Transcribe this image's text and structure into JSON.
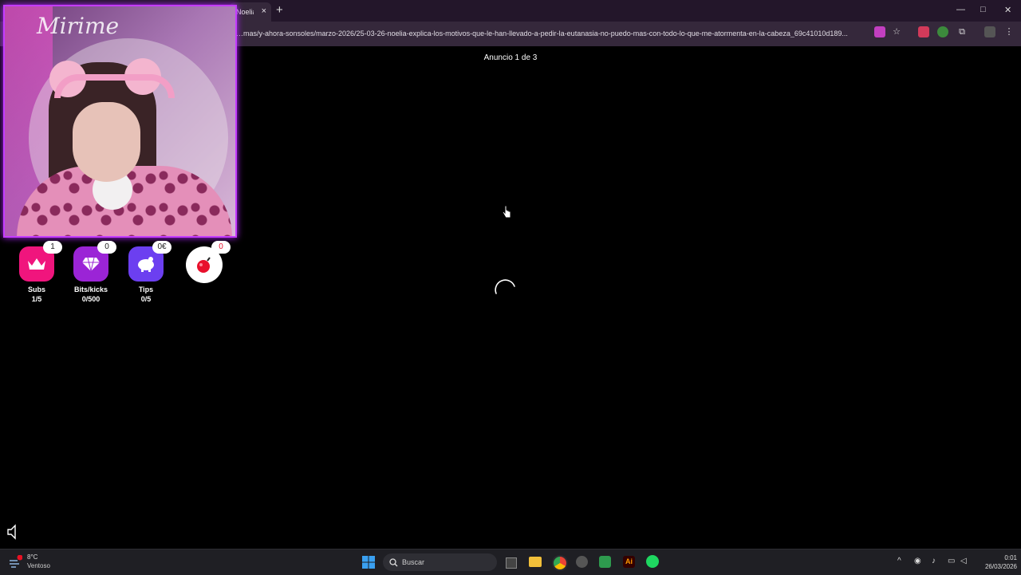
{
  "browser": {
    "tab_title": "Noelia",
    "tab_close": "×",
    "new_tab": "+",
    "url": "…mas/y-ahora-sonsoles/marzo-2026/25-03-26-noelia-explica-los-motivos-que-le-han-llevado-a-pedir-la-eutanasia-no-puedo-mas-con-todo-lo-que-me-atormenta-en-la-cabeza_69c41010d189...",
    "window_controls": [
      "—",
      "□",
      "✕"
    ]
  },
  "page": {
    "ad_label": "Anuncio 1 de 3"
  },
  "overlay": {
    "cam_logo_text": "Mirime",
    "goals": [
      {
        "label": "Subs",
        "value": "1/5",
        "count": "1",
        "icon": "crown-icon",
        "color": "#f0157d"
      },
      {
        "label": "Bits/kicks",
        "value": "0/500",
        "count": "0",
        "icon": "diamond-icon",
        "color": "#9b24d6"
      },
      {
        "label": "Tips",
        "value": "0/5",
        "count": "0€",
        "icon": "piggy-bank-icon",
        "color": "#6c3ff0"
      },
      {
        "label": "",
        "value": "",
        "count": "0",
        "icon": "bomb-icon",
        "color": "#ffffff"
      }
    ]
  },
  "taskbar": {
    "weather_temp": "8°C",
    "weather_condition": "Ventoso",
    "search_placeholder": "Buscar",
    "time": "0:01",
    "date": "26/03/2026"
  }
}
